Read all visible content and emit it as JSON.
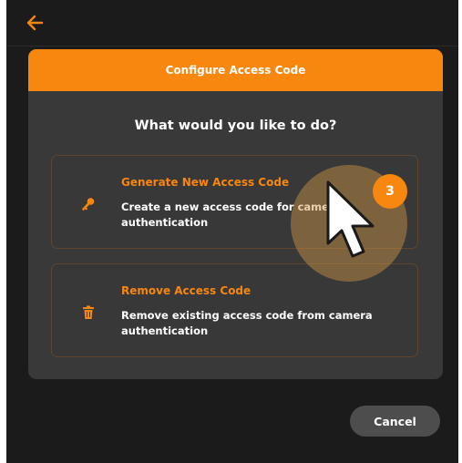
{
  "header": {
    "back_icon": "arrow-left-icon"
  },
  "dialog": {
    "title": "Configure Access Code",
    "question": "What would you like to do?"
  },
  "options": [
    {
      "icon": "key-icon",
      "title": "Generate New Access Code",
      "description": "Create a new access code for camera authentication"
    },
    {
      "icon": "trash-icon",
      "title": "Remove Access Code",
      "description": "Remove existing access code from camera authentication"
    }
  ],
  "footer": {
    "cancel_label": "Cancel"
  },
  "annotation": {
    "step_number": "3"
  },
  "colors": {
    "accent": "#f7870f",
    "background": "#1b1b1b",
    "card": "#393939",
    "option_border": "#5d4530",
    "button": "#4d4d4d"
  }
}
